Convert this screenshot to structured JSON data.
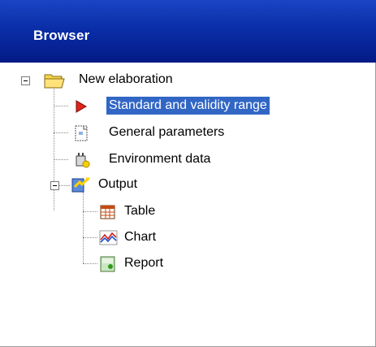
{
  "window": {
    "title": "Browser"
  },
  "tree": {
    "root": {
      "label": "New elaboration",
      "icon": "folder-open-icon",
      "expanded": true
    },
    "items": [
      {
        "label": "Standard and validity range",
        "icon": "red-arrow-icon",
        "selected": true
      },
      {
        "label": "General parameters",
        "icon": "document-icon"
      },
      {
        "label": "Environment data",
        "icon": "environment-data-icon"
      },
      {
        "label": "Output",
        "icon": "output-icon",
        "expanded": true,
        "children": [
          {
            "label": "Table",
            "icon": "table-icon"
          },
          {
            "label": "Chart",
            "icon": "chart-icon"
          },
          {
            "label": "Report",
            "icon": "report-icon"
          }
        ]
      }
    ]
  },
  "colors": {
    "header": "#0a2ea8",
    "header_text": "#ffffff",
    "selection": "#3166c5",
    "selection_text": "#ffffff",
    "connector": "#8a8a8a"
  }
}
